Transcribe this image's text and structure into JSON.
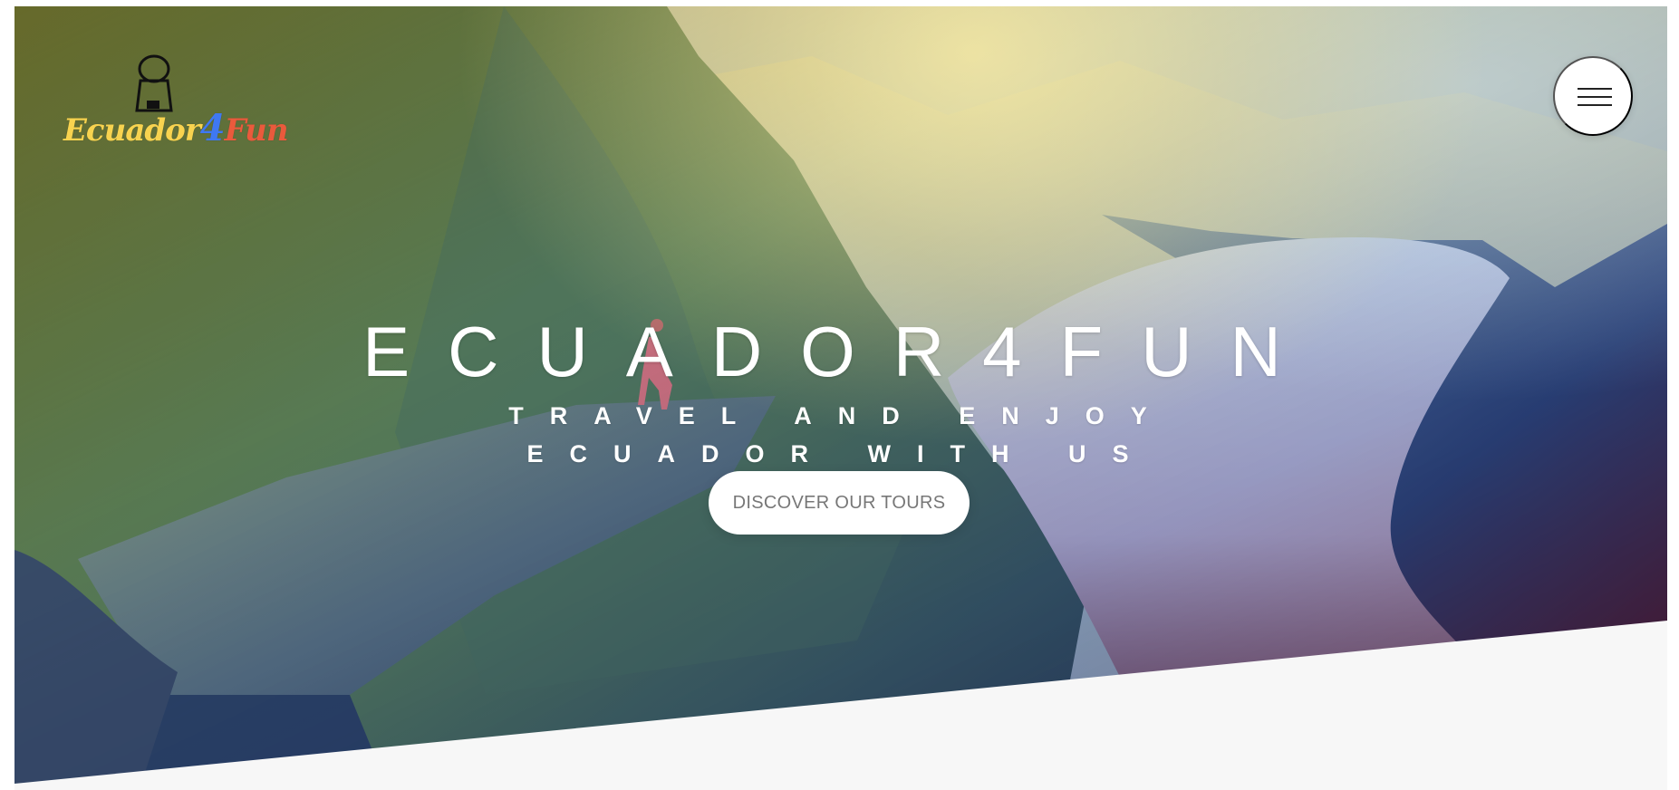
{
  "brand": {
    "logo_word_1": "Ecuador",
    "logo_word_2": "4",
    "logo_word_3": "Fun",
    "logo_icon": "jar-icon",
    "colors": {
      "yellow": "#f8d34f",
      "blue": "#3f78f2",
      "red": "#ea5a3c"
    }
  },
  "header": {
    "menu_icon": "hamburger-menu-icon"
  },
  "hero": {
    "title": "ECUADOR4FUN",
    "subtitle": "TRAVEL AND ENJOY ECUADOR WITH US",
    "cta_label": "DISCOVER OUR TOURS"
  },
  "colors": {
    "background": "#f7f7f7",
    "button": "#ffffff",
    "button_text": "#777777"
  }
}
